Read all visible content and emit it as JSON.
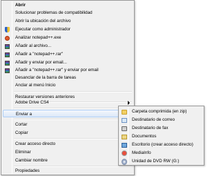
{
  "context_menu": {
    "items": [
      {
        "label": "Abrir",
        "bold": true,
        "icon": "none"
      },
      {
        "label": "Solucionar problemas de compatibilidad",
        "icon": "none"
      },
      {
        "label": "Abrir la ubicación del archivo",
        "icon": "none"
      },
      {
        "label": "Ejecutar como administrador",
        "icon": "uac-shield-icon"
      },
      {
        "label": "Analizar notepad++.exe",
        "icon": "antivirus-icon"
      },
      {
        "label": "Añadir al archivo...",
        "icon": "winrar-icon"
      },
      {
        "label": "Añadir a \"notepad++.rar\"",
        "icon": "winrar-icon"
      },
      {
        "label": "Añadir y enviar por email...",
        "icon": "winrar-icon"
      },
      {
        "label": "Añadir a \"notepad++.rar\" y enviar por email",
        "icon": "winrar-icon"
      },
      {
        "label": "Desanclar de la barra de tareas",
        "icon": "none"
      },
      {
        "label": "Anclar al menú Inicio",
        "icon": "none"
      },
      {
        "label": "Restaurar versiones anteriores",
        "icon": "none"
      },
      {
        "label": "Adobe Drive CS4",
        "icon": "none",
        "submenu": true
      },
      {
        "label": "Enviar a",
        "icon": "none",
        "submenu": true,
        "highlighted": true
      },
      {
        "label": "Cortar",
        "icon": "none"
      },
      {
        "label": "Copiar",
        "icon": "none"
      },
      {
        "label": "Crear acceso directo",
        "icon": "none"
      },
      {
        "label": "Eliminar",
        "icon": "none"
      },
      {
        "label": "Cambiar nombre",
        "icon": "none"
      },
      {
        "label": "Propiedades",
        "icon": "none"
      }
    ]
  },
  "send_to_submenu": {
    "items": [
      {
        "label": "Carpeta comprimida (en zip)",
        "icon": "zip-folder-icon"
      },
      {
        "label": "Destinatario de correo",
        "icon": "mail-icon"
      },
      {
        "label": "Destinatario de fax",
        "icon": "fax-icon"
      },
      {
        "label": "Documentos",
        "icon": "documents-folder-icon"
      },
      {
        "label": "Escritorio (crear acceso directo)",
        "icon": "desktop-icon"
      },
      {
        "label": "MediaInfo",
        "icon": "mediainfo-icon"
      },
      {
        "label": "Unidad de DVD RW (G:)",
        "icon": "dvd-drive-icon"
      }
    ]
  }
}
